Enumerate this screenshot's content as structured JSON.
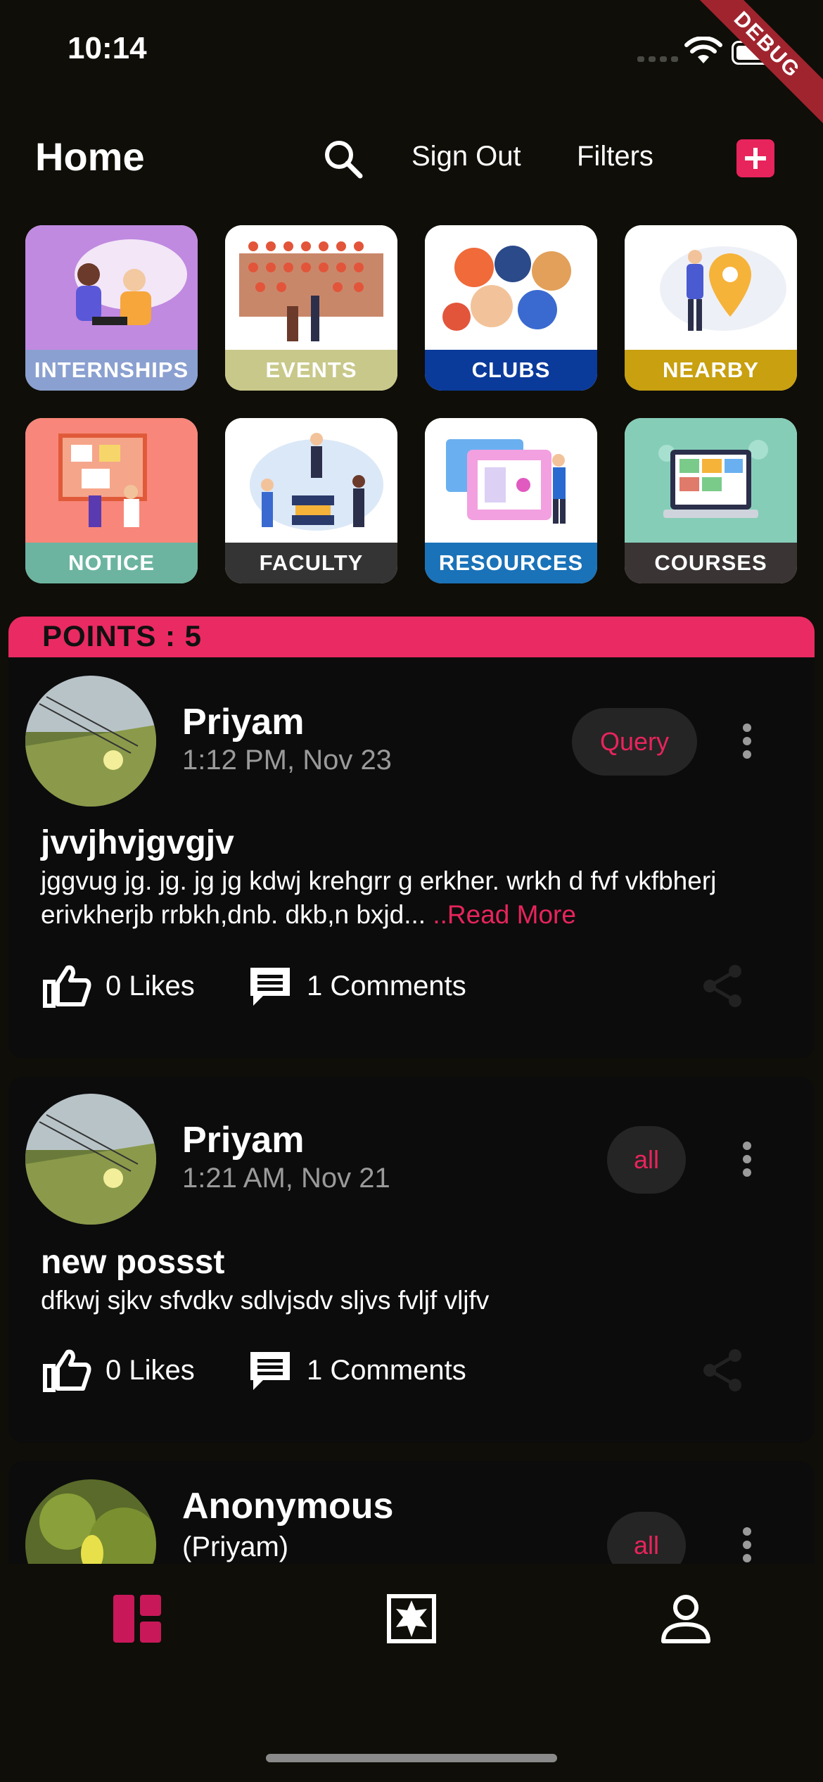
{
  "status_bar": {
    "time": "10:14",
    "debug_label": "DEBUG"
  },
  "app_bar": {
    "title": "Home",
    "search_icon": "search-icon",
    "sign_out_label": "Sign Out",
    "filters_label": "Filters",
    "add_icon": "add-box-icon"
  },
  "categories": [
    {
      "label": "INTERNSHIPS",
      "color": "#8aa0d0"
    },
    {
      "label": "EVENTS",
      "color": "#c8c88a"
    },
    {
      "label": "CLUBS",
      "color": "#0a3a9a"
    },
    {
      "label": "NEARBY",
      "color": "#c8a010"
    },
    {
      "label": "NOTICE",
      "color": "#6cb4a0"
    },
    {
      "label": "FACULTY",
      "color": "#343434"
    },
    {
      "label": "RESOURCES",
      "color": "#1a72b8"
    },
    {
      "label": "COURSES",
      "color": "#3a3434"
    }
  ],
  "points": {
    "label": "POINTS : 5"
  },
  "posts": [
    {
      "author": "Priyam",
      "time": "1:12 PM,  Nov 23",
      "tag": "Query",
      "title": "jvvjhvjgvgjv",
      "body": "jggvug jg. jg. jg jg kdwj krehgrr g erkher. wrkh d fvf vkfbherj erivkherjb rrbkh,dnb.   dkb,n bxjd...",
      "read_more": " ..Read More",
      "likes": "0 Likes",
      "comments": "1 Comments"
    },
    {
      "author": "Priyam",
      "time": "1:21 AM,  Nov 21",
      "tag": "all",
      "title": "new possst",
      "body": "dfkwj sjkv sfvdkv sdlvjsdv sljvs fvljf vljfv",
      "likes": "0 Likes",
      "comments": "1 Comments"
    },
    {
      "author": "Anonymous",
      "subtitle": "(Priyam)",
      "tag": "all"
    }
  ],
  "colors": {
    "accent": "#e8245c",
    "background": "#0f0e08",
    "card": "#0c0c0c"
  },
  "bottom_nav": [
    {
      "icon": "dashboard-icon",
      "active": true
    },
    {
      "icon": "puzzle-icon",
      "active": false
    },
    {
      "icon": "person-icon",
      "active": false
    }
  ]
}
